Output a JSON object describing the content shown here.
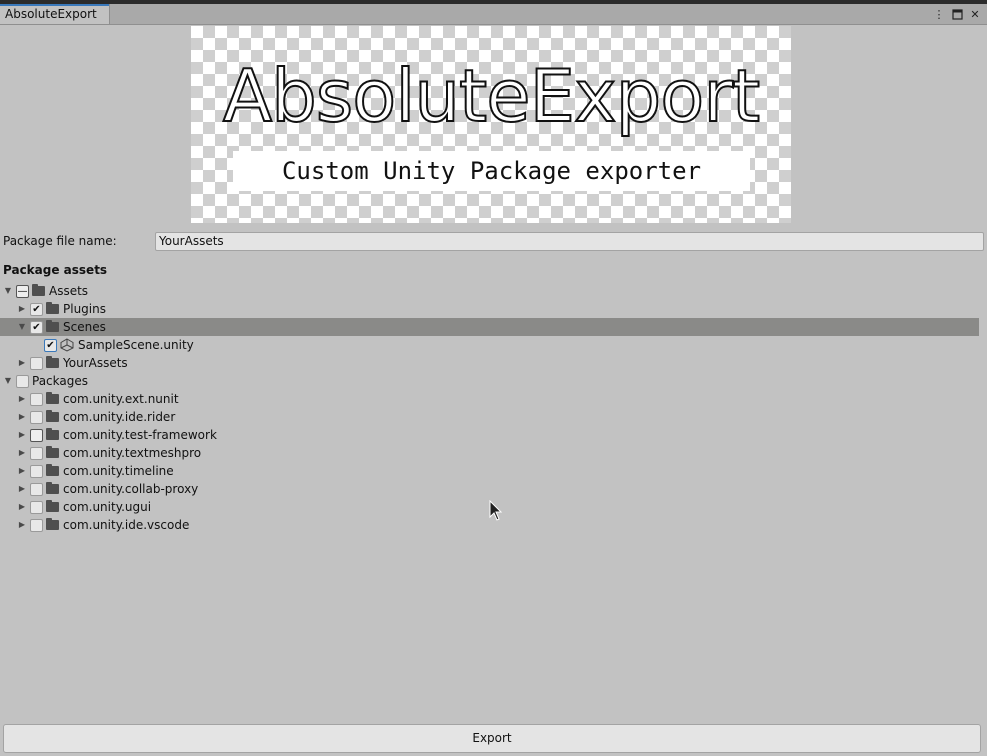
{
  "window": {
    "tab_title": "AbsoluteExport",
    "controls": {
      "menu_icon": "kebab-menu-icon",
      "maximize_icon": "maximize-icon",
      "close_icon": "close-icon"
    }
  },
  "banner": {
    "title": "AbsoluteExport",
    "subtitle": "Custom Unity Package exporter"
  },
  "form": {
    "package_file_name_label": "Package file name:",
    "package_file_name_value": "YourAssets"
  },
  "assets_section": {
    "title": "Package assets"
  },
  "tree": {
    "assets": {
      "label": "Assets",
      "state": "mixed",
      "children": [
        {
          "label": "Plugins",
          "state": "checked",
          "expanded": false
        },
        {
          "label": "Scenes",
          "state": "checked",
          "expanded": true,
          "selected": true,
          "children": [
            {
              "label": "SampleScene.unity",
              "state": "checked",
              "icon": "unity-scene-icon"
            }
          ]
        },
        {
          "label": "YourAssets",
          "state": "unchecked",
          "expanded": false
        }
      ]
    },
    "packages": {
      "label": "Packages",
      "state": "unchecked",
      "children": [
        {
          "label": "com.unity.ext.nunit",
          "state": "unchecked"
        },
        {
          "label": "com.unity.ide.rider",
          "state": "unchecked"
        },
        {
          "label": "com.unity.test-framework",
          "state": "unchecked",
          "focused": true
        },
        {
          "label": "com.unity.textmeshpro",
          "state": "unchecked"
        },
        {
          "label": "com.unity.timeline",
          "state": "unchecked"
        },
        {
          "label": "com.unity.collab-proxy",
          "state": "unchecked"
        },
        {
          "label": "com.unity.ugui",
          "state": "unchecked"
        },
        {
          "label": "com.unity.ide.vscode",
          "state": "unchecked"
        }
      ]
    }
  },
  "footer": {
    "export_label": "Export"
  },
  "colors": {
    "background": "#c2c2c2",
    "selected_row": "#8a8a88",
    "tab_accent": "#3a79bb"
  }
}
